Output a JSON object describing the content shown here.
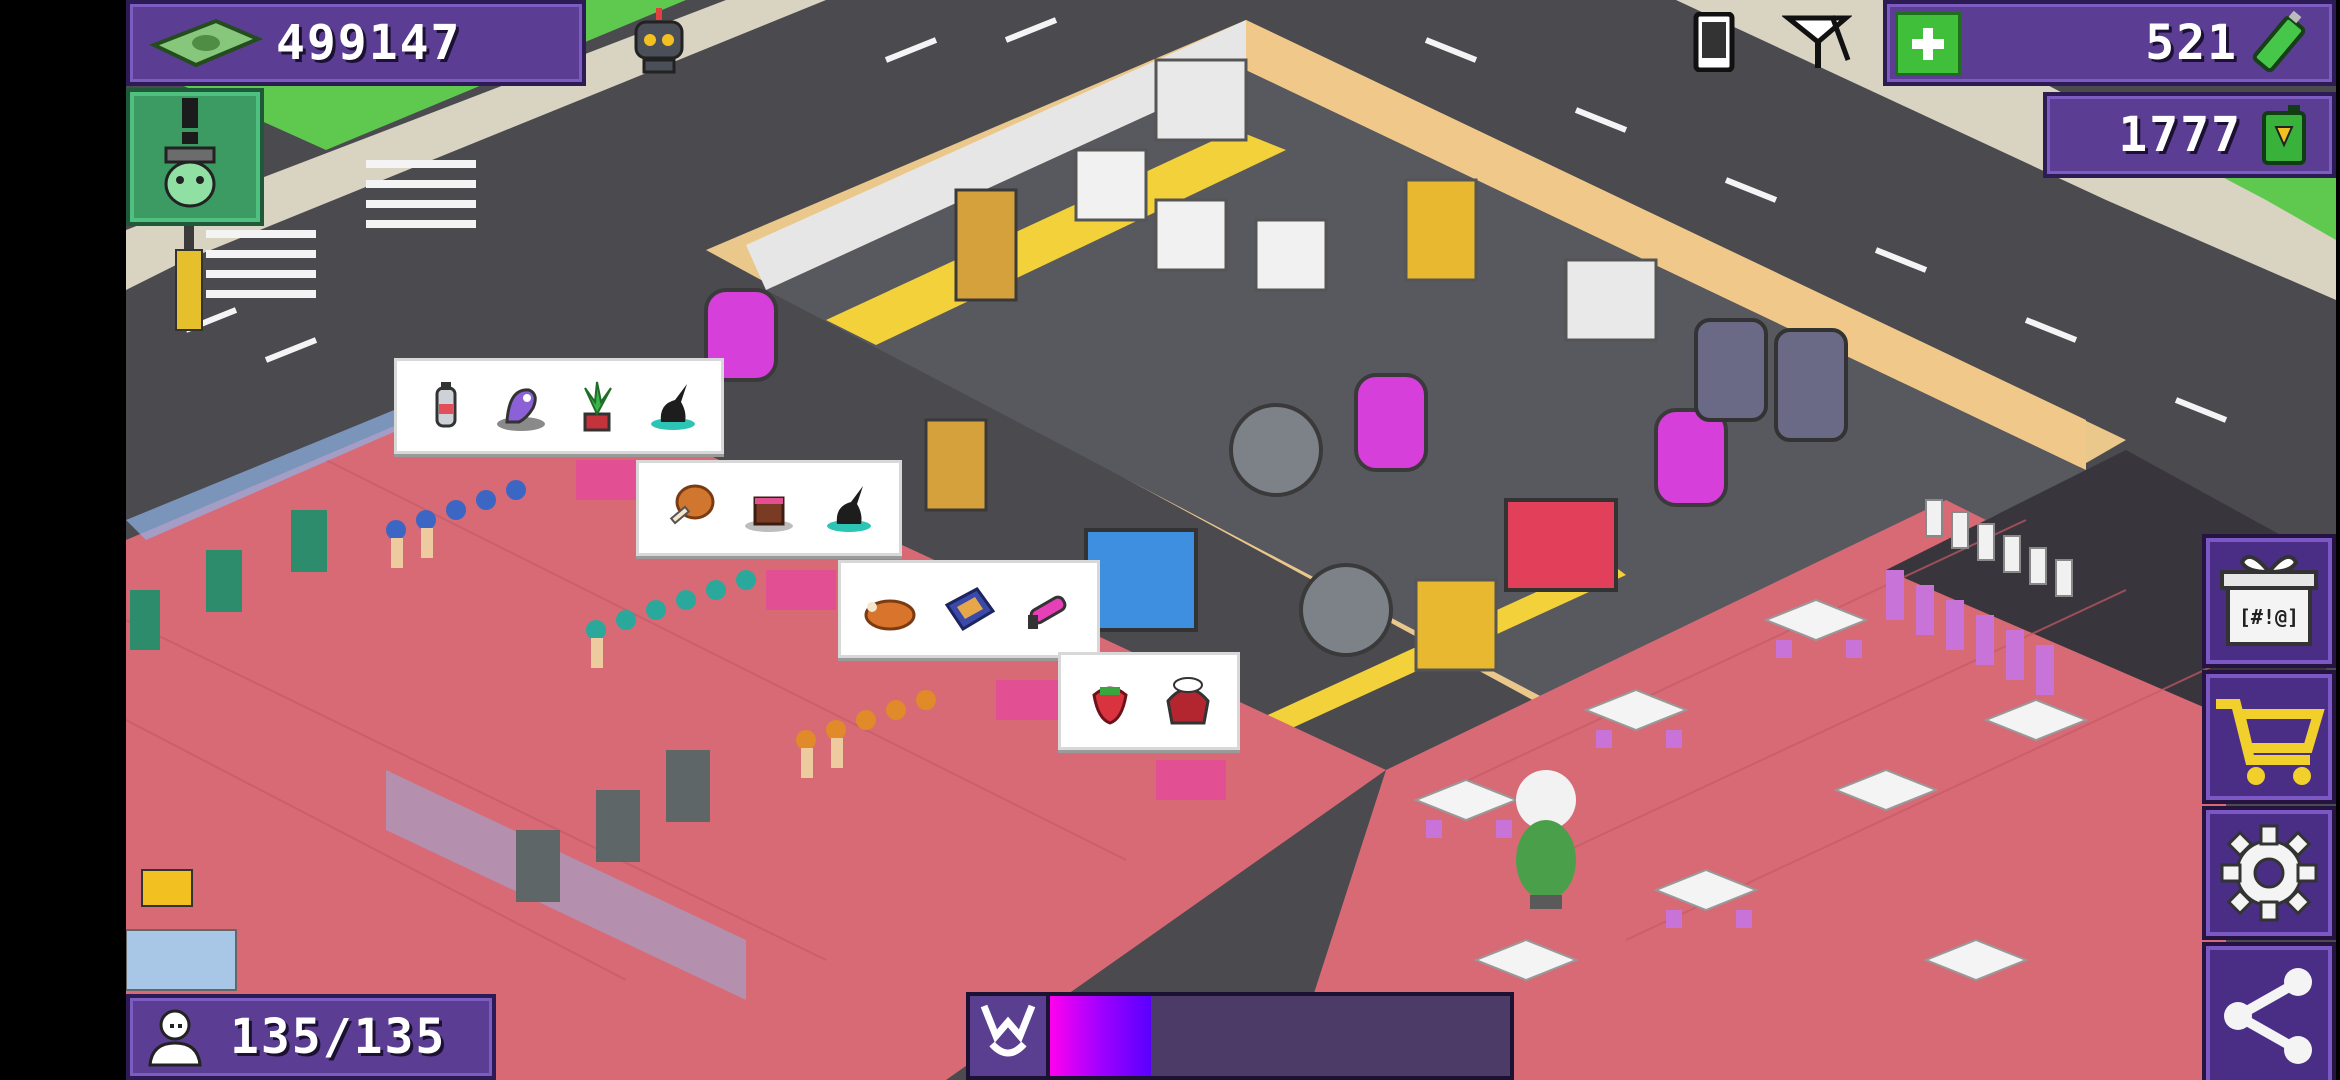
{
  "hud": {
    "money": "499147",
    "energy": "521",
    "fuel": "1777",
    "population": "135/135",
    "gift_label": "[#!@]"
  },
  "icons": {
    "money": "banknote-icon",
    "energy": "battery-icon",
    "fuel": "fuel-can-icon",
    "population": "person-icon",
    "alert": "alien-alert-icon",
    "robot": "robot-icon",
    "phone": "phone-icon",
    "signal": "antenna-icon",
    "add": "plus-icon",
    "gift": "gift-icon",
    "shop": "cart-icon",
    "settings": "gear-icon",
    "share": "share-icon",
    "meter": "happy-icon"
  },
  "orders": [
    {
      "items": [
        "canister-icon",
        "alien-plant-icon",
        "potted-plant-icon",
        "black-flask-icon"
      ]
    },
    {
      "items": [
        "drumstick-icon",
        "cake-icon",
        "black-flask-icon"
      ]
    },
    {
      "items": [
        "roast-chicken-icon",
        "comic-book-icon",
        "raygun-icon"
      ]
    },
    {
      "items": [
        "strawberry-icon",
        "jelly-dessert-icon"
      ]
    }
  ],
  "meter": {
    "level": 0.22
  },
  "colors": {
    "hud_purple": "#5b3e93",
    "floor_pink": "#d86a75",
    "grass": "#5ec94e",
    "road": "#4c4c50",
    "energy_green": "#3fbf3a"
  }
}
